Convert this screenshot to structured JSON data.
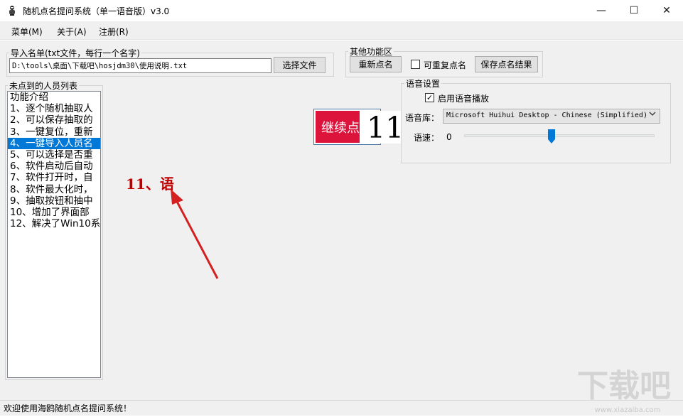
{
  "window": {
    "title": "随机点名提问系统（单一语音版）v3.0",
    "controls": {
      "minimize": "—",
      "maximize": "☐",
      "close": "✕"
    }
  },
  "menu": [
    "菜单(M)",
    "关于(A)",
    "注册(R)"
  ],
  "import_group": {
    "legend": "导入名单(txt文件，每行一个名字)",
    "path_value": "D:\\tools\\桌面\\下载吧\\hosjdm30\\使用说明.txt",
    "choose_file_label": "选择文件"
  },
  "other_group": {
    "legend": "其他功能区",
    "reset_label": "重新点名",
    "repeat_label": "可重复点名",
    "repeat_checked": false,
    "save_label": "保存点名结果"
  },
  "list_group": {
    "legend": "未点到的人员列表",
    "items": [
      "功能介绍",
      "1、逐个随机抽取人",
      "2、可以保存抽取的",
      "3、一键复位，重新",
      "4、一键导入人员名",
      "5、可以选择是否重",
      "6、软件启动后自动",
      "7、软件打开时，自",
      "8、软件最大化时，",
      "9、抽取按钮和抽中",
      "10、增加了界面部",
      "12、解决了Win10系"
    ],
    "selected_index": 4
  },
  "call": {
    "button_label": "继续点名",
    "name_display": "11"
  },
  "voice": {
    "legend": "语音设置",
    "enable_label": "启用语音播放",
    "enable_checked": true,
    "check_glyph": "✓",
    "library_label": "语音库：",
    "library_value": "Microsoft Huihui Desktop - Chinese (Simplified)",
    "speed_label": "语速：",
    "speed_value": "0",
    "speed_fraction": 0.46
  },
  "annotation": {
    "text": "11、语",
    "color": "#c00000"
  },
  "status": {
    "text": "欢迎使用海鸥随机点名提问系统！"
  },
  "watermark": {
    "text": "下载吧",
    "url": "www.xiazaiba.com"
  },
  "colors": {
    "selection": "#0078d7",
    "call_button": "#dc143c",
    "accent_border": "#4a76a8"
  }
}
